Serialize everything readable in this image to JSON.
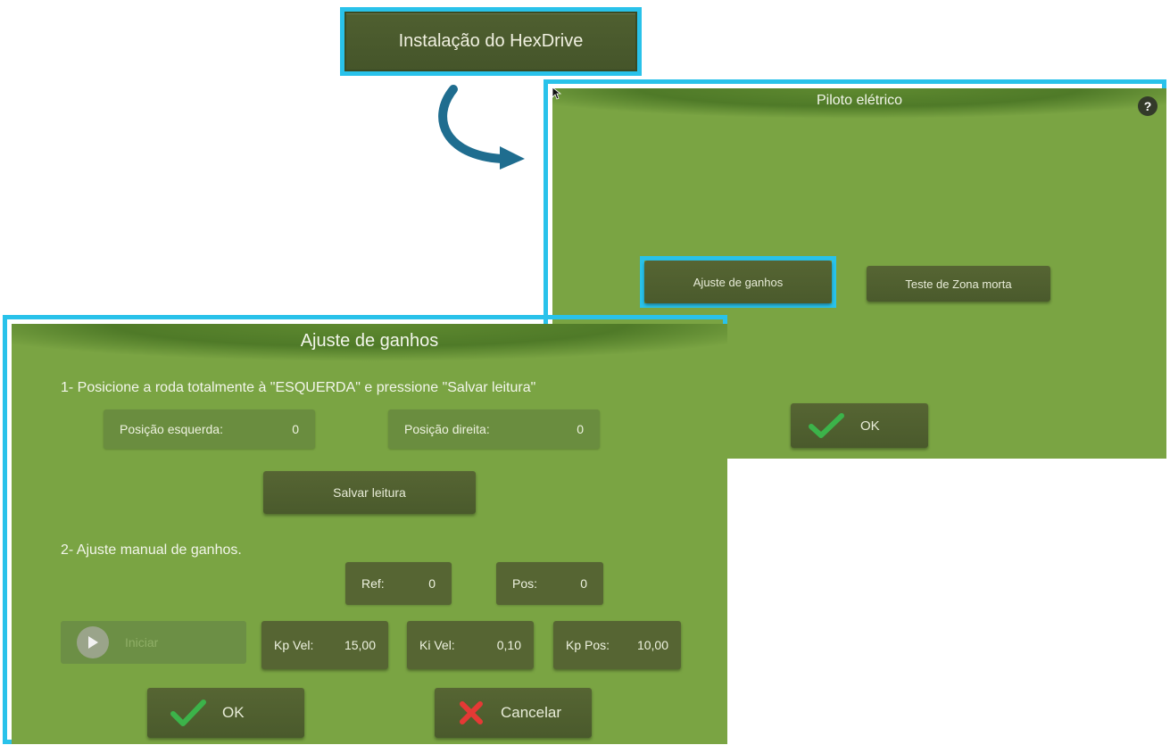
{
  "install": {
    "label": "Instalação do HexDrive"
  },
  "piloto": {
    "title": "Piloto elétrico",
    "help": "?",
    "buttons": {
      "ajuste": "Ajuste de ganhos",
      "zona": "Teste de Zona morta",
      "ok": "OK"
    }
  },
  "ajuste": {
    "title": "Ajuste de ganhos",
    "step1": "1- Posicione a roda totalmente à \"ESQUERDA\" e pressione \"Salvar leitura\"",
    "pos_esq": {
      "label": "Posição esquerda:",
      "value": "0"
    },
    "pos_dir": {
      "label": "Posição direita:",
      "value": "0"
    },
    "salvar": "Salvar leitura",
    "step2": "2- Ajuste manual de ganhos.",
    "ref": {
      "label": "Ref:",
      "value": "0"
    },
    "pos": {
      "label": "Pos:",
      "value": "0"
    },
    "iniciar": "Iniciar",
    "kp_vel": {
      "label": "Kp Vel:",
      "value": "15,00"
    },
    "ki_vel": {
      "label": "Ki Vel:",
      "value": "0,10"
    },
    "kp_pos": {
      "label": "Kp Pos:",
      "value": "10,00"
    },
    "ok": "OK",
    "cancel": "Cancelar"
  },
  "colors": {
    "highlight": "#29c2ea",
    "panel": "#7aa443",
    "button": "#4e5e2f",
    "check": "#3cb34a",
    "cross": "#e53935"
  }
}
